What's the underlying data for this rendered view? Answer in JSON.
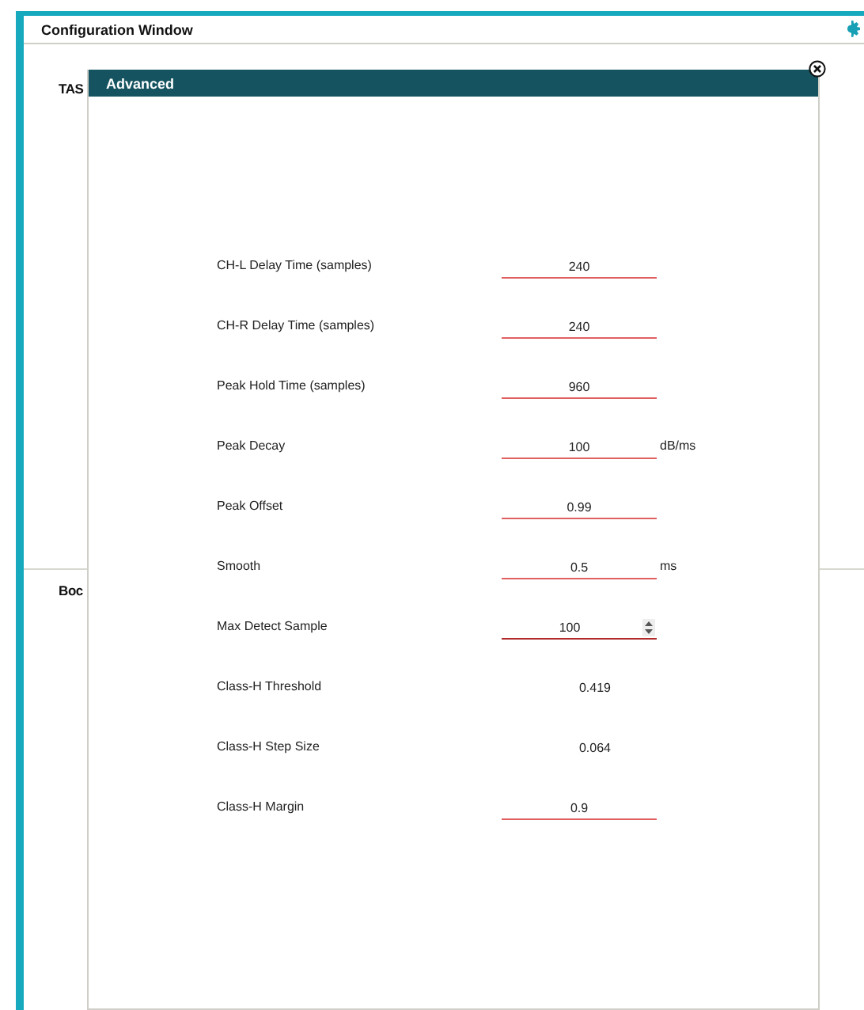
{
  "window": {
    "title": "Configuration Window"
  },
  "background_sections": [
    "TAS",
    "Boc"
  ],
  "dialog": {
    "title": "Advanced",
    "rows": [
      {
        "label": "CH-L Delay Time (samples)",
        "kind": "input",
        "value": "240"
      },
      {
        "label": "CH-R Delay Time (samples)",
        "kind": "input",
        "value": "240"
      },
      {
        "label": "Peak Hold Time (samples)",
        "kind": "input",
        "value": "960"
      },
      {
        "label": "Peak Decay",
        "kind": "input",
        "value": "100",
        "unit": "dB/ms"
      },
      {
        "label": "Peak Offset",
        "kind": "input",
        "value": "0.99"
      },
      {
        "label": "Smooth",
        "kind": "input",
        "value": "0.5",
        "unit": "ms"
      },
      {
        "label": "Max Detect Sample",
        "kind": "number",
        "value": "100"
      },
      {
        "label": "Class-H Threshold",
        "kind": "readonly",
        "value": "0.419"
      },
      {
        "label": "Class-H Step Size",
        "kind": "readonly",
        "value": "0.064"
      },
      {
        "label": "Class-H Margin",
        "kind": "input",
        "value": "0.9"
      }
    ]
  }
}
